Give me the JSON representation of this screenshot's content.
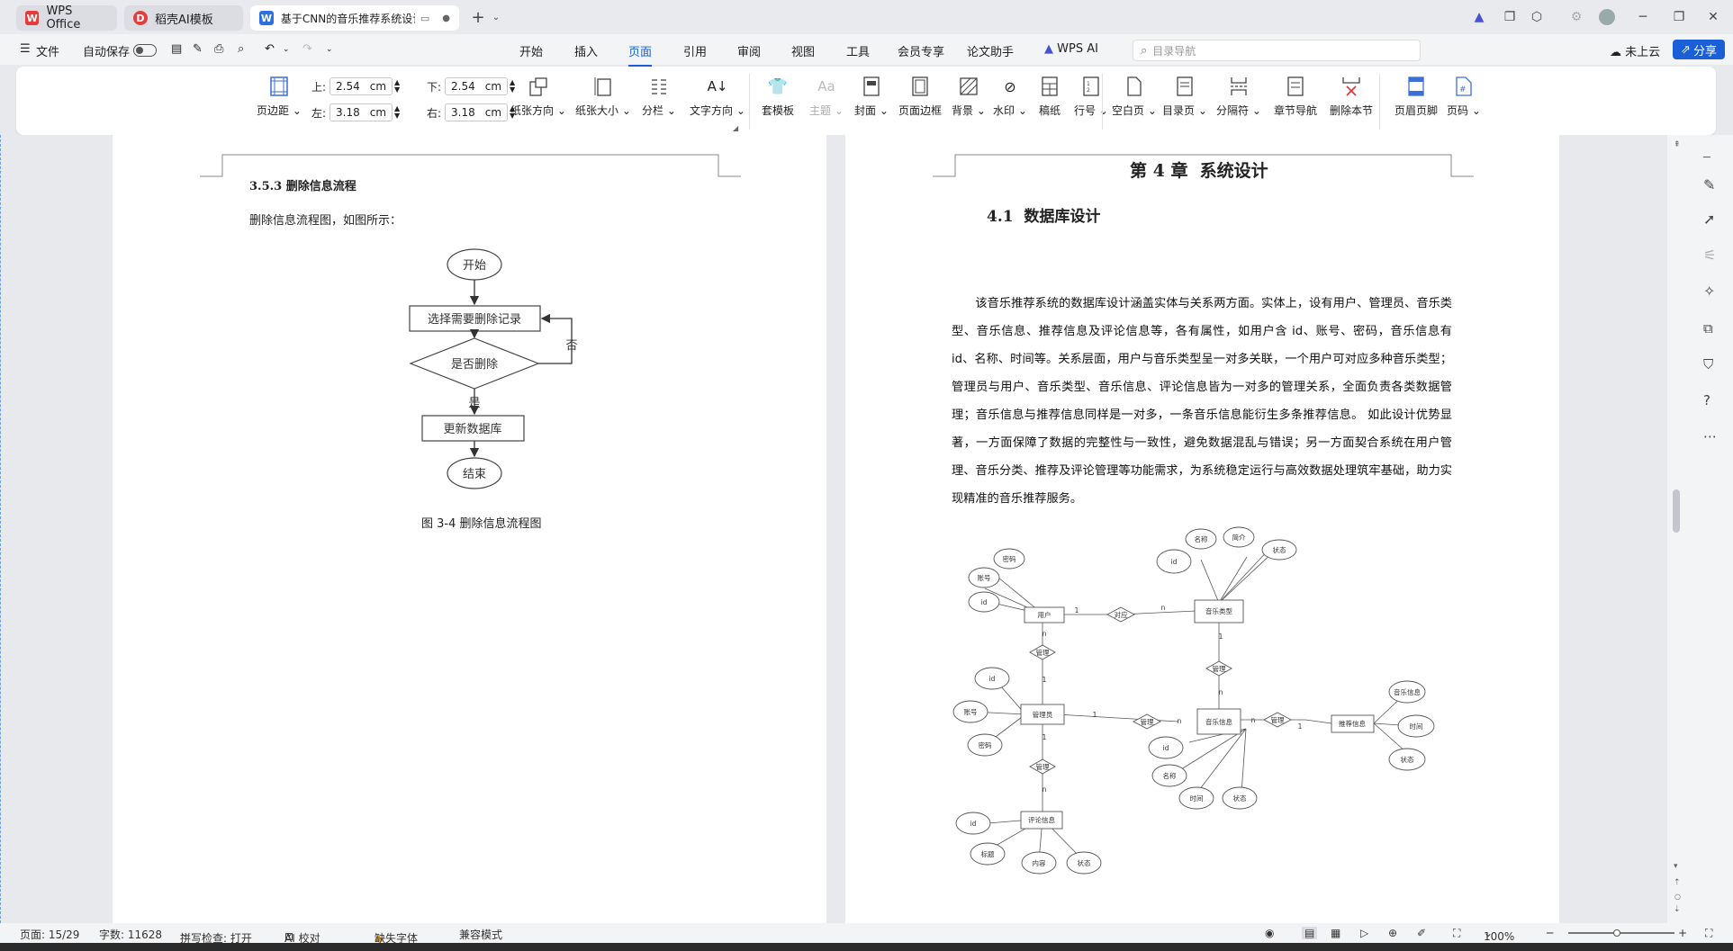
{
  "tabs": [
    {
      "label": "WPS Office"
    },
    {
      "label": "稻壳AI模板"
    },
    {
      "label": "基于CNN的音乐推荐系统设计"
    }
  ],
  "menu": {
    "file": "文件",
    "autosave": "自动保存",
    "items": [
      "开始",
      "插入",
      "页面",
      "引用",
      "审阅",
      "视图",
      "工具",
      "会员专享",
      "论文助手",
      "WPS AI"
    ],
    "search_placeholder": "目录导航",
    "cloud": "未上云",
    "share": "分享"
  },
  "ribbon": {
    "margin_label": "页边距",
    "top_label": "上:",
    "top_value": "2.54",
    "unit": "cm",
    "bottom_label": "下:",
    "bottom_value": "2.54",
    "left_label": "左:",
    "left_value": "3.18",
    "right_label": "右:",
    "right_value": "3.18",
    "buttons": [
      "纸张方向",
      "纸张大小",
      "分栏",
      "文字方向",
      "套模板",
      "主题",
      "封面",
      "页面边框",
      "背景",
      "水印",
      "稿纸",
      "行号",
      "空白页",
      "目录页",
      "分隔符",
      "章节导航",
      "删除本节",
      "页眉页脚",
      "页码"
    ]
  },
  "left_page": {
    "section_heading": "3.5.3 删除信息流程",
    "intro": "删除信息流程图，如图所示：",
    "flow": {
      "start": "开始",
      "select": "选择需要删除记录",
      "decision": "是否删除",
      "no": "否",
      "yes": "是",
      "update": "更新数据库",
      "end": "结束"
    },
    "caption": "图 3-4 删除信息流程图"
  },
  "right_page": {
    "chapter_title": "第 4 章  系统设计",
    "section_title": "4.1  数据库设计",
    "paragraph": "该音乐推荐系统的数据库设计涵盖实体与关系两方面。实体上，设有用户、管理员、音乐类型、音乐信息、推荐信息及评论信息等，各有属性，如用户含 id、账号、密码，音乐信息有 id、名称、时间等。关系层面，用户与音乐类型呈一对多关联，一个用户可对应多种音乐类型；管理员与用户、音乐类型、音乐信息、评论信息皆为一对多的管理关系，全面负责各类数据管理；音乐信息与推荐信息同样是一对多，一条音乐信息能衍生多条推荐信息。 如此设计优势显著，一方面保障了数据的完整性与一致性，避免数据混乱与错误；另一方面契合系统在用户管理、音乐分类、推荐及评论管理等功能需求，为系统稳定运行与高效数据处理筑牢基础，助力实现精准的音乐推荐服务。",
    "er": {
      "user": "用户",
      "admin": "管理员",
      "music_type": "音乐类型",
      "music_info": "音乐信息",
      "recommend": "推荐信息",
      "comment": "评论信息",
      "rel_correspond": "对应",
      "rel_manage": "管理",
      "attr_id": "id",
      "attr_account": "账号",
      "attr_password": "密码",
      "attr_name": "名称",
      "attr_intro": "简介",
      "attr_status": "状态",
      "attr_time": "时间",
      "attr_title": "标题",
      "attr_content": "内容",
      "attr_musicinfo": "音乐信息",
      "card_1": "1",
      "card_n": "n"
    }
  },
  "status": {
    "page": "页面: 15/29",
    "words": "字数: 11628",
    "spell": "拼写检查: 打开",
    "ai_check": "AI 校对",
    "missing_font": "缺失字体",
    "compat": "兼容模式",
    "zoom": "100%"
  },
  "colors": {
    "accent": "#1a5fd7",
    "wps_red": "#e23c3c"
  }
}
